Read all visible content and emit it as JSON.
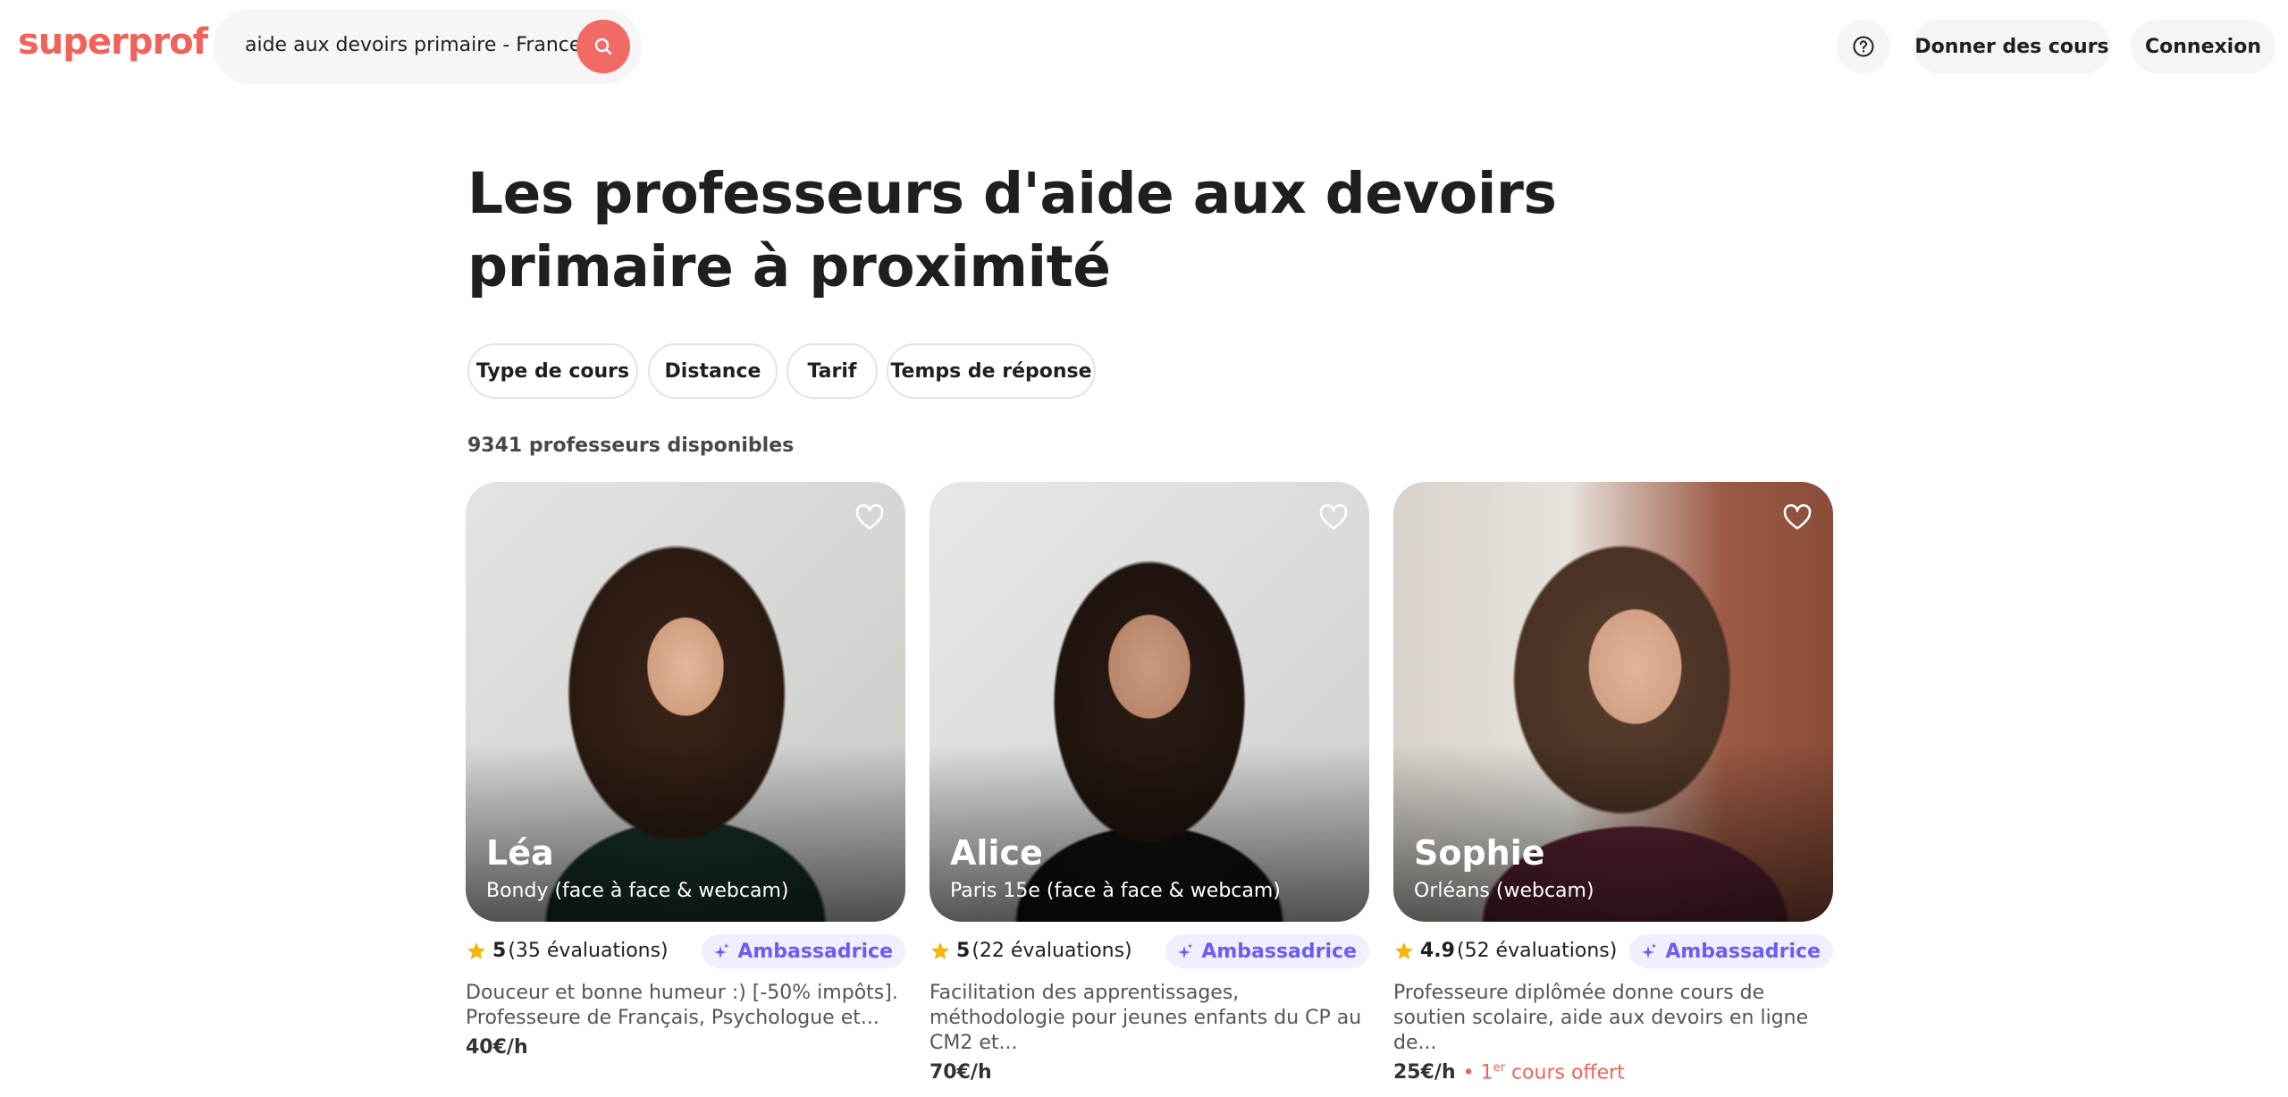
{
  "header": {
    "logo": "superprof",
    "search_value": "aide aux devoirs primaire - France",
    "search_icon": "search-icon",
    "help_icon": "help-circle-icon",
    "give_lessons": "Donner des cours",
    "login": "Connexion"
  },
  "main": {
    "title": "Les professeurs d'aide aux devoirs primaire à proximité",
    "filters": [
      "Type de cours",
      "Distance",
      "Tarif",
      "Temps de réponse"
    ],
    "results_count": "9341 professeurs disponibles"
  },
  "colors": {
    "brand": "#f0625a",
    "badge_text": "#6b5cf6",
    "badge_bg": "#f0efff",
    "star": "#f5b50a"
  },
  "cards": [
    {
      "name": "Léa",
      "location": "Bondy (face à face & webcam)",
      "score": "5",
      "reviews": "(35 évaluations)",
      "badge": "Ambassadrice",
      "description": "Douceur et bonne humeur :) [-50% impôts]. Professeure de Français, Psychologue et...",
      "price": "40€/h",
      "offer": ""
    },
    {
      "name": "Alice",
      "location": "Paris 15e (face à face & webcam)",
      "score": "5",
      "reviews": "(22 évaluations)",
      "badge": "Ambassadrice",
      "description": "Facilitation des apprentissages, méthodologie pour jeunes enfants du CP au CM2 et...",
      "price": "70€/h",
      "offer": ""
    },
    {
      "name": "Sophie",
      "location": "Orléans (webcam)",
      "score": "4.9",
      "reviews": "(52 évaluations)",
      "badge": "Ambassadrice",
      "description": "Professeure diplômée donne cours de soutien scolaire, aide aux devoirs en ligne de...",
      "price": "25€/h",
      "offer_separator": "•",
      "offer_num": "1",
      "offer_sup": "er",
      "offer_text": " cours offert"
    }
  ]
}
